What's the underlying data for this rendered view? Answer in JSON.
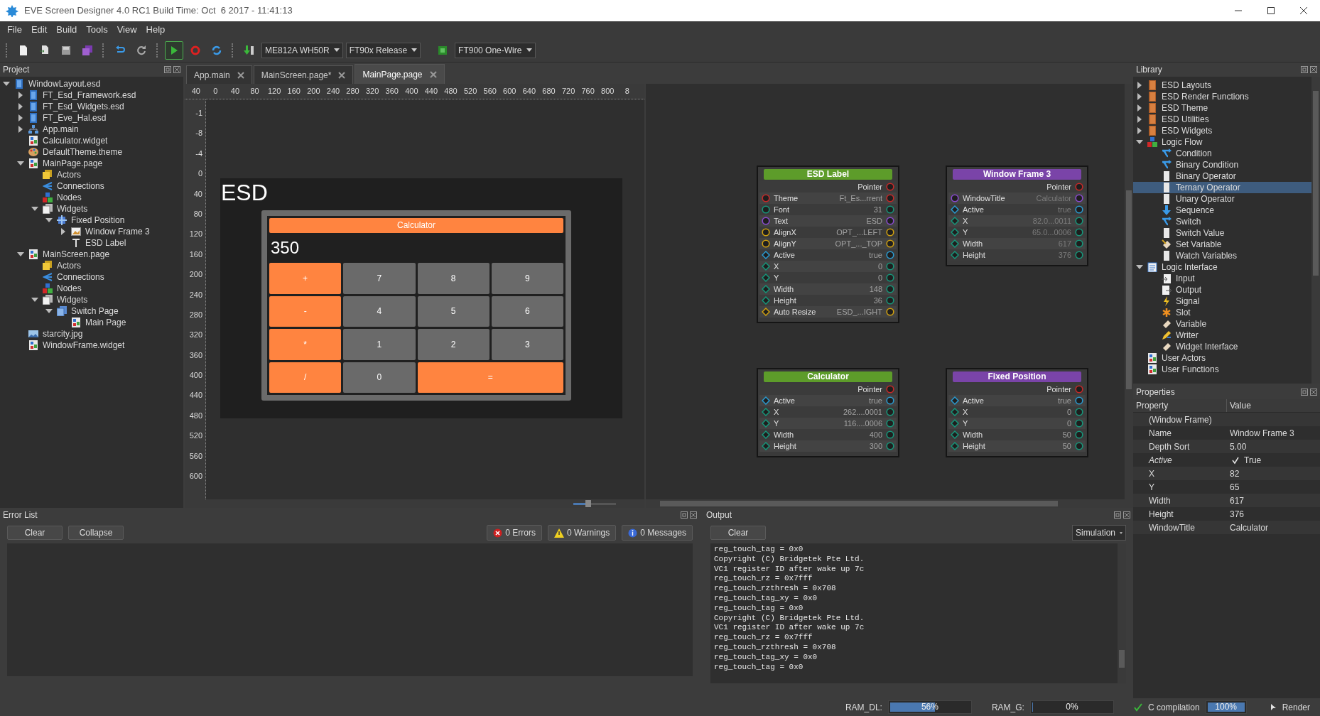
{
  "window": {
    "title": "EVE Screen Designer 4.0 RC1 Build Time: Oct  6 2017 - 11:41:13"
  },
  "menu": [
    "File",
    "Edit",
    "Build",
    "Tools",
    "View",
    "Help"
  ],
  "toolbar": {
    "run_pressed": true,
    "dropdowns": [
      "ME812A WH50R",
      "FT90x Release",
      "FT900 One-Wire"
    ]
  },
  "project": {
    "title": "Project",
    "tree": [
      {
        "label": "WindowLayout.esd",
        "kind": "esd",
        "expanded": true,
        "children": [
          {
            "label": "FT_Esd_Framework.esd",
            "kind": "esd",
            "expanded": false
          },
          {
            "label": "FT_Esd_Widgets.esd",
            "kind": "esd",
            "expanded": false
          },
          {
            "label": "FT_Eve_Hal.esd",
            "kind": "esd",
            "expanded": false
          },
          {
            "label": "App.main",
            "kind": "app",
            "expanded": false
          },
          {
            "label": "Calculator.widget",
            "kind": "page"
          },
          {
            "label": "DefaultTheme.theme",
            "kind": "theme"
          },
          {
            "label": "MainPage.page",
            "kind": "page",
            "expanded": true,
            "children": [
              {
                "label": "Actors",
                "kind": "actors"
              },
              {
                "label": "Connections",
                "kind": "connections"
              },
              {
                "label": "Nodes",
                "kind": "nodes"
              },
              {
                "label": "Widgets",
                "kind": "widgets",
                "expanded": true,
                "children": [
                  {
                    "label": "Fixed Position",
                    "kind": "layout",
                    "expanded": true,
                    "children": [
                      {
                        "label": "Window Frame 3",
                        "kind": "frame",
                        "expanded": false
                      },
                      {
                        "label": "ESD Label",
                        "kind": "label"
                      }
                    ]
                  }
                ]
              }
            ]
          },
          {
            "label": "MainScreen.page",
            "kind": "page",
            "expanded": true,
            "children": [
              {
                "label": "Actors",
                "kind": "actors"
              },
              {
                "label": "Connections",
                "kind": "connections"
              },
              {
                "label": "Nodes",
                "kind": "nodes"
              },
              {
                "label": "Widgets",
                "kind": "widgets",
                "expanded": true,
                "children": [
                  {
                    "label": "Switch Page",
                    "kind": "switch",
                    "expanded": true,
                    "children": [
                      {
                        "label": "Main Page",
                        "kind": "page"
                      }
                    ]
                  }
                ]
              }
            ]
          },
          {
            "label": "starcity.jpg",
            "kind": "image"
          },
          {
            "label": "WindowFrame.widget",
            "kind": "page"
          }
        ]
      }
    ]
  },
  "tabs": [
    {
      "label": "App.main",
      "selected": false
    },
    {
      "label": "MainScreen.page*",
      "selected": false
    },
    {
      "label": "MainPage.page",
      "selected": true
    }
  ],
  "ruler": {
    "x_labels": [
      "40",
      "0",
      "40",
      "80",
      "120",
      "160",
      "200",
      "240",
      "280",
      "320",
      "360",
      "400",
      "440",
      "480",
      "520",
      "560",
      "600",
      "640",
      "680",
      "720",
      "760",
      "800",
      "8"
    ],
    "y_labels": [
      "-1",
      "-8",
      "-4",
      "0",
      "40",
      "80",
      "120",
      "160",
      "200",
      "240",
      "280",
      "320",
      "360",
      "400",
      "440",
      "480",
      "520",
      "560",
      "600"
    ]
  },
  "screen": {
    "label": "ESD",
    "calculator": {
      "title": "Calculator",
      "display": "350",
      "keys": [
        {
          "label": "+",
          "kind": "op"
        },
        {
          "label": "7",
          "kind": "num"
        },
        {
          "label": "8",
          "kind": "num"
        },
        {
          "label": "9",
          "kind": "num"
        },
        {
          "label": "-",
          "kind": "op"
        },
        {
          "label": "4",
          "kind": "num"
        },
        {
          "label": "5",
          "kind": "num"
        },
        {
          "label": "6",
          "kind": "num"
        },
        {
          "label": "*",
          "kind": "op"
        },
        {
          "label": "1",
          "kind": "num"
        },
        {
          "label": "2",
          "kind": "num"
        },
        {
          "label": "3",
          "kind": "num"
        },
        {
          "label": "/",
          "kind": "op"
        },
        {
          "label": "0",
          "kind": "num"
        },
        {
          "label": "=",
          "kind": "wide"
        }
      ]
    }
  },
  "graph": {
    "nodes": [
      {
        "title": "ESD Label",
        "color": "#5d9c2a",
        "values_dimmed": false,
        "rows": [
          {
            "kind": "pointer",
            "label": "Pointer"
          },
          {
            "kind": "theme",
            "label": "Theme",
            "value": "Ft_Es...rrent"
          },
          {
            "kind": "number",
            "label": "Font",
            "value": "31"
          },
          {
            "kind": "string",
            "label": "Text",
            "value": "ESD"
          },
          {
            "kind": "enum",
            "label": "AlignX",
            "value": "OPT_...LEFT"
          },
          {
            "kind": "enum",
            "label": "AlignY",
            "value": "OPT_..._TOP"
          },
          {
            "kind": "bool",
            "label": "Active",
            "value": "true"
          },
          {
            "kind": "coord",
            "label": "X",
            "value": "0"
          },
          {
            "kind": "coord",
            "label": "Y",
            "value": "0"
          },
          {
            "kind": "coord",
            "label": "Width",
            "value": "148"
          },
          {
            "kind": "coord",
            "label": "Height",
            "value": "36"
          },
          {
            "kind": "flag",
            "label": "Auto Resize",
            "value": "ESD_...IGHT"
          }
        ]
      },
      {
        "title": "Window Frame 3",
        "color": "#7a44a8",
        "values_dimmed": true,
        "rows": [
          {
            "kind": "pointer",
            "label": "Pointer"
          },
          {
            "kind": "string",
            "label": "WindowTitle",
            "value": "Calculator"
          },
          {
            "kind": "bool",
            "label": "Active",
            "value": "true"
          },
          {
            "kind": "coord",
            "label": "X",
            "value": "82.0...0011"
          },
          {
            "kind": "coord",
            "label": "Y",
            "value": "65.0...0006"
          },
          {
            "kind": "coord",
            "label": "Width",
            "value": "617"
          },
          {
            "kind": "coord",
            "label": "Height",
            "value": "376"
          }
        ]
      },
      {
        "title": "Calculator",
        "color": "#5d9c2a",
        "values_dimmed": false,
        "rows": [
          {
            "kind": "pointer",
            "label": "Pointer"
          },
          {
            "kind": "bool",
            "label": "Active",
            "value": "true"
          },
          {
            "kind": "coord",
            "label": "X",
            "value": "262....0001"
          },
          {
            "kind": "coord",
            "label": "Y",
            "value": "116....0006"
          },
          {
            "kind": "coord",
            "label": "Width",
            "value": "400"
          },
          {
            "kind": "coord",
            "label": "Height",
            "value": "300"
          }
        ]
      },
      {
        "title": "Fixed Position",
        "color": "#7a44a8",
        "values_dimmed": false,
        "rows": [
          {
            "kind": "pointer",
            "label": "Pointer"
          },
          {
            "kind": "bool",
            "label": "Active",
            "value": "true"
          },
          {
            "kind": "coord",
            "label": "X",
            "value": "0"
          },
          {
            "kind": "coord",
            "label": "Y",
            "value": "0"
          },
          {
            "kind": "coord",
            "label": "Width",
            "value": "50"
          },
          {
            "kind": "coord",
            "label": "Height",
            "value": "50"
          }
        ]
      }
    ]
  },
  "library": {
    "title": "Library",
    "tree": [
      {
        "label": "ESD Layouts",
        "kind": "book",
        "expanded": false,
        "selected": false
      },
      {
        "label": "ESD Render Functions",
        "kind": "book",
        "expanded": false,
        "selected": false
      },
      {
        "label": "ESD Theme",
        "kind": "book",
        "expanded": false,
        "selected": false
      },
      {
        "label": "ESD Utilities",
        "kind": "book",
        "expanded": false,
        "selected": false
      },
      {
        "label": "ESD Widgets",
        "kind": "book",
        "expanded": false,
        "selected": false
      },
      {
        "label": "Logic Flow",
        "kind": "nodes",
        "expanded": true,
        "selected": false,
        "children": [
          {
            "label": "Condition",
            "kind": "branch",
            "selected": false
          },
          {
            "label": "Binary Condition",
            "kind": "branch",
            "selected": false
          },
          {
            "label": "Binary Operator",
            "kind": "blank",
            "selected": false
          },
          {
            "label": "Ternary Operator",
            "kind": "blank",
            "selected": true
          },
          {
            "label": "Unary Operator",
            "kind": "blank",
            "selected": false
          },
          {
            "label": "Sequence",
            "kind": "down",
            "selected": false
          },
          {
            "label": "Switch",
            "kind": "branch",
            "selected": false
          },
          {
            "label": "Switch Value",
            "kind": "blank",
            "selected": false
          },
          {
            "label": "Set Variable",
            "kind": "setvar",
            "selected": false
          },
          {
            "label": "Watch Variables",
            "kind": "blank",
            "selected": false
          }
        ]
      },
      {
        "label": "Logic Interface",
        "kind": "interface",
        "expanded": true,
        "selected": false,
        "children": [
          {
            "label": "Input",
            "kind": "input",
            "selected": false
          },
          {
            "label": "Output",
            "kind": "output",
            "selected": false
          },
          {
            "label": "Signal",
            "kind": "signal",
            "selected": false
          },
          {
            "label": "Slot",
            "kind": "slot",
            "selected": false
          },
          {
            "label": "Variable",
            "kind": "variable",
            "selected": false
          },
          {
            "label": "Writer",
            "kind": "writer",
            "selected": false
          },
          {
            "label": "Widget Interface",
            "kind": "variable",
            "selected": false
          }
        ]
      },
      {
        "label": "User Actors",
        "kind": "page",
        "selected": false
      },
      {
        "label": "User Functions",
        "kind": "page",
        "selected": false
      }
    ]
  },
  "properties": {
    "title": "Properties",
    "columns": [
      "Property",
      "Value"
    ],
    "rows": [
      {
        "kind": "group",
        "property": "(Window Frame)"
      },
      {
        "kind": "text",
        "property": "Name",
        "value": "Window Frame 3",
        "italic": false
      },
      {
        "kind": "text",
        "property": "Depth Sort",
        "value": "5.00",
        "italic": false
      },
      {
        "kind": "checkbox",
        "property": "Active",
        "value": "True",
        "checked": true,
        "italic": true
      },
      {
        "kind": "text",
        "property": "X",
        "value": "82",
        "italic": false
      },
      {
        "kind": "text",
        "property": "Y",
        "value": "65",
        "italic": false
      },
      {
        "kind": "text",
        "property": "Width",
        "value": "617",
        "italic": false
      },
      {
        "kind": "text",
        "property": "Height",
        "value": "376",
        "italic": false
      },
      {
        "kind": "text",
        "property": "WindowTitle",
        "value": "Calculator",
        "italic": false
      }
    ]
  },
  "error_list": {
    "title": "Error List",
    "buttons": [
      "Clear",
      "Collapse"
    ],
    "filters": [
      {
        "kind": "error",
        "label": "0 Errors"
      },
      {
        "kind": "warning",
        "label": "0 Warnings"
      },
      {
        "kind": "info",
        "label": "0 Messages"
      }
    ]
  },
  "output": {
    "title": "Output",
    "clear": "Clear",
    "mode": "Simulation",
    "lines": [
      "reg_touch_tag = 0x0",
      "Copyright (C) Bridgetek Pte Ltd.",
      "VC1 register ID after wake up 7c",
      "reg_touch_rz = 0x7fff",
      "reg_touch_rzthresh = 0x708",
      "reg_touch_tag_xy = 0x0",
      "reg_touch_tag = 0x0",
      "Copyright (C) Bridgetek Pte Ltd.",
      "VC1 register ID after wake up 7c",
      "reg_touch_rz = 0x7fff",
      "reg_touch_rzthresh = 0x708",
      "reg_touch_tag_xy = 0x0",
      "reg_touch_tag = 0x0"
    ]
  },
  "canvas_zoom": {
    "level": 0.35
  },
  "status_bar": {
    "ram_dl": {
      "label": "RAM_DL:",
      "reading": "56%",
      "level": 0.56
    },
    "ram_g": {
      "label": "RAM_G:",
      "reading": "0%",
      "level": 0
    },
    "compilation": {
      "label": "C compilation",
      "reading": "100%",
      "level": 1
    },
    "render": "Render"
  }
}
